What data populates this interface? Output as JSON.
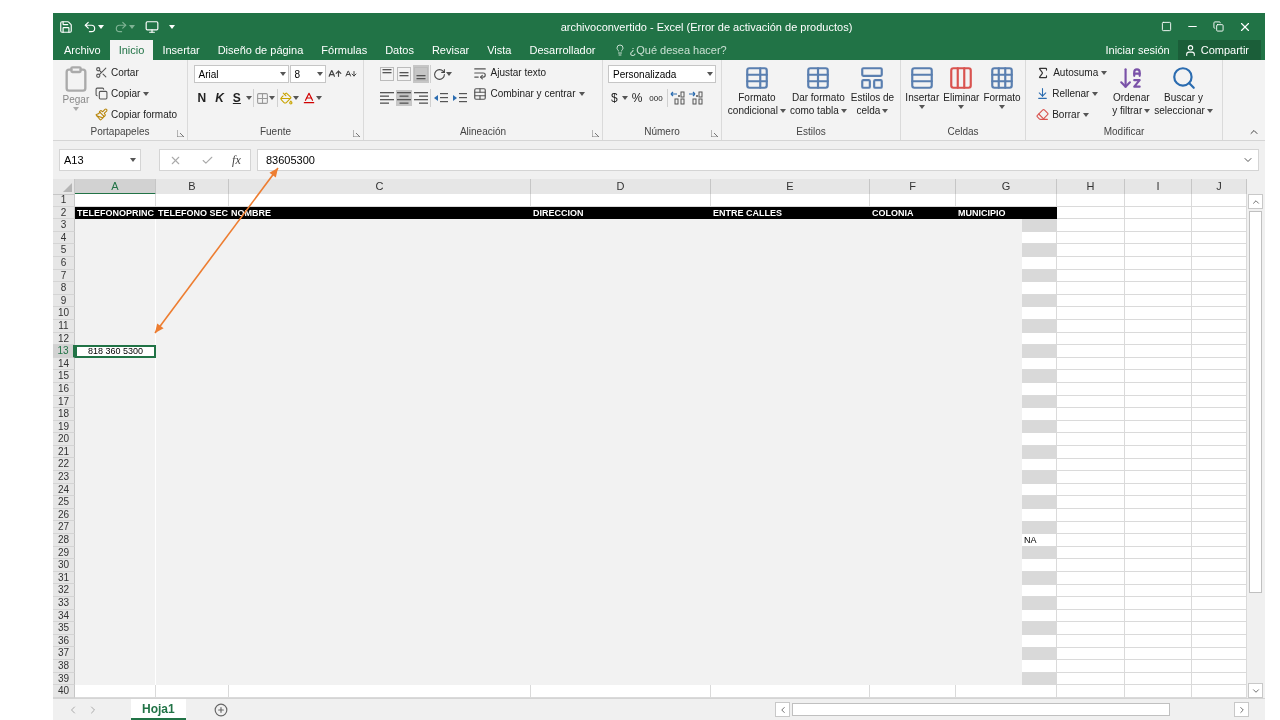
{
  "window": {
    "title": "archivoconvertido - Excel (Error de activación de productos)"
  },
  "ribbon_tabs": [
    {
      "label": "Archivo",
      "selected": false
    },
    {
      "label": "Inicio",
      "selected": true
    },
    {
      "label": "Insertar",
      "selected": false
    },
    {
      "label": "Diseño de página",
      "selected": false
    },
    {
      "label": "Fórmulas",
      "selected": false
    },
    {
      "label": "Datos",
      "selected": false
    },
    {
      "label": "Revisar",
      "selected": false
    },
    {
      "label": "Vista",
      "selected": false
    },
    {
      "label": "Desarrollador",
      "selected": false
    }
  ],
  "tell_me": {
    "placeholder": "¿Qué desea hacer?"
  },
  "account": {
    "sign_in": "Iniciar sesión",
    "share": "Compartir"
  },
  "clipboard": {
    "label": "Portapapeles",
    "paste": "Pegar",
    "cut": "Cortar",
    "copy": "Copiar",
    "format_painter": "Copiar formato"
  },
  "font": {
    "label": "Fuente",
    "font_name": "Arial",
    "font_size": "8",
    "bold": "N",
    "italic": "K",
    "underline": "S"
  },
  "alignment": {
    "label": "Alineación",
    "wrap_text": "Ajustar texto",
    "merge_center": "Combinar y centrar",
    "vertical": [
      {
        "selected": false
      },
      {
        "selected": false
      },
      {
        "selected": true
      }
    ],
    "horizontal": [
      {
        "selected": false
      },
      {
        "selected": true
      },
      {
        "selected": false
      }
    ]
  },
  "number": {
    "label": "Número",
    "format": "Personalizada",
    "currency": "$",
    "percent": "%",
    "thousands": "000"
  },
  "styles": {
    "label": "Estilos",
    "buttons": [
      {
        "lines": [
          "Formato",
          "condicional"
        ]
      },
      {
        "lines": [
          "Dar formato",
          "como tabla"
        ]
      },
      {
        "lines": [
          "Estilos de",
          "celda"
        ]
      }
    ]
  },
  "cells": {
    "label": "Celdas",
    "buttons": [
      "Insertar",
      "Eliminar",
      "Formato"
    ]
  },
  "editing": {
    "label": "Modificar",
    "autosum": "Autosuma",
    "fill": "Rellenar",
    "clear": "Borrar",
    "sort": [
      "Ordenar",
      "y filtrar"
    ],
    "find": [
      "Buscar y",
      "seleccionar"
    ]
  },
  "formula_bar": {
    "name_box": "A13",
    "function_label": "fx",
    "value": "83605300"
  },
  "columns": [
    {
      "label": "A",
      "selected": true
    },
    {
      "label": "B",
      "selected": false
    },
    {
      "label": "C",
      "selected": false
    },
    {
      "label": "D",
      "selected": false
    },
    {
      "label": "E",
      "selected": false
    },
    {
      "label": "F",
      "selected": false
    },
    {
      "label": "G",
      "selected": false
    },
    {
      "label": "H",
      "selected": false
    },
    {
      "label": "I",
      "selected": false
    },
    {
      "label": "J",
      "selected": false
    }
  ],
  "rows": [
    {
      "number": "1",
      "selected": false,
      "kind": "blank"
    },
    {
      "number": "2",
      "selected": false,
      "kind": "header",
      "cells": {
        "col_a": "TELEFONOPRINC",
        "col_b": "TELEFONO SEC",
        "col_c": "NOMBRE",
        "col_d": "DIRECCION",
        "col_e": "ENTRE CALLES",
        "col_f": "COLONIA",
        "col_g": "MUNICIPIO"
      }
    },
    {
      "number": "3",
      "selected": false,
      "kind": "shaded"
    },
    {
      "number": "4",
      "selected": false,
      "kind": "shaded"
    },
    {
      "number": "5",
      "selected": false,
      "kind": "shaded"
    },
    {
      "number": "6",
      "selected": false,
      "kind": "shaded"
    },
    {
      "number": "7",
      "selected": false,
      "kind": "shaded"
    },
    {
      "number": "8",
      "selected": false,
      "kind": "shaded"
    },
    {
      "number": "9",
      "selected": false,
      "kind": "shaded"
    },
    {
      "number": "10",
      "selected": false,
      "kind": "shaded"
    },
    {
      "number": "11",
      "selected": false,
      "kind": "shaded"
    },
    {
      "number": "12",
      "selected": false,
      "kind": "shaded"
    },
    {
      "number": "13",
      "selected": true,
      "kind": "shaded",
      "cells": {
        "col_a": "818 360 5300"
      }
    },
    {
      "number": "14",
      "selected": false,
      "kind": "shaded"
    },
    {
      "number": "15",
      "selected": false,
      "kind": "shaded"
    },
    {
      "number": "16",
      "selected": false,
      "kind": "shaded"
    },
    {
      "number": "17",
      "selected": false,
      "kind": "shaded"
    },
    {
      "number": "18",
      "selected": false,
      "kind": "shaded"
    },
    {
      "number": "19",
      "selected": false,
      "kind": "shaded"
    },
    {
      "number": "20",
      "selected": false,
      "kind": "shaded"
    },
    {
      "number": "21",
      "selected": false,
      "kind": "shaded"
    },
    {
      "number": "22",
      "selected": false,
      "kind": "shaded"
    },
    {
      "number": "23",
      "selected": false,
      "kind": "shaded"
    },
    {
      "number": "24",
      "selected": false,
      "kind": "shaded"
    },
    {
      "number": "25",
      "selected": false,
      "kind": "shaded"
    },
    {
      "number": "26",
      "selected": false,
      "kind": "shaded"
    },
    {
      "number": "27",
      "selected": false,
      "kind": "shaded"
    },
    {
      "number": "28",
      "selected": false,
      "kind": "shaded",
      "cells": {
        "col_g": "NA"
      }
    },
    {
      "number": "29",
      "selected": false,
      "kind": "shaded"
    },
    {
      "number": "30",
      "selected": false,
      "kind": "shaded"
    },
    {
      "number": "31",
      "selected": false,
      "kind": "shaded"
    },
    {
      "number": "32",
      "selected": false,
      "kind": "shaded"
    },
    {
      "number": "33",
      "selected": false,
      "kind": "shaded"
    },
    {
      "number": "34",
      "selected": false,
      "kind": "shaded"
    },
    {
      "number": "35",
      "selected": false,
      "kind": "shaded"
    },
    {
      "number": "36",
      "selected": false,
      "kind": "shaded"
    },
    {
      "number": "37",
      "selected": false,
      "kind": "shaded"
    },
    {
      "number": "38",
      "selected": false,
      "kind": "shaded"
    },
    {
      "number": "39",
      "selected": false,
      "kind": "shaded"
    },
    {
      "number": "40",
      "selected": false,
      "kind": "blank"
    }
  ],
  "sheet_tabs": [
    {
      "label": "Hoja1",
      "selected": true
    }
  ]
}
